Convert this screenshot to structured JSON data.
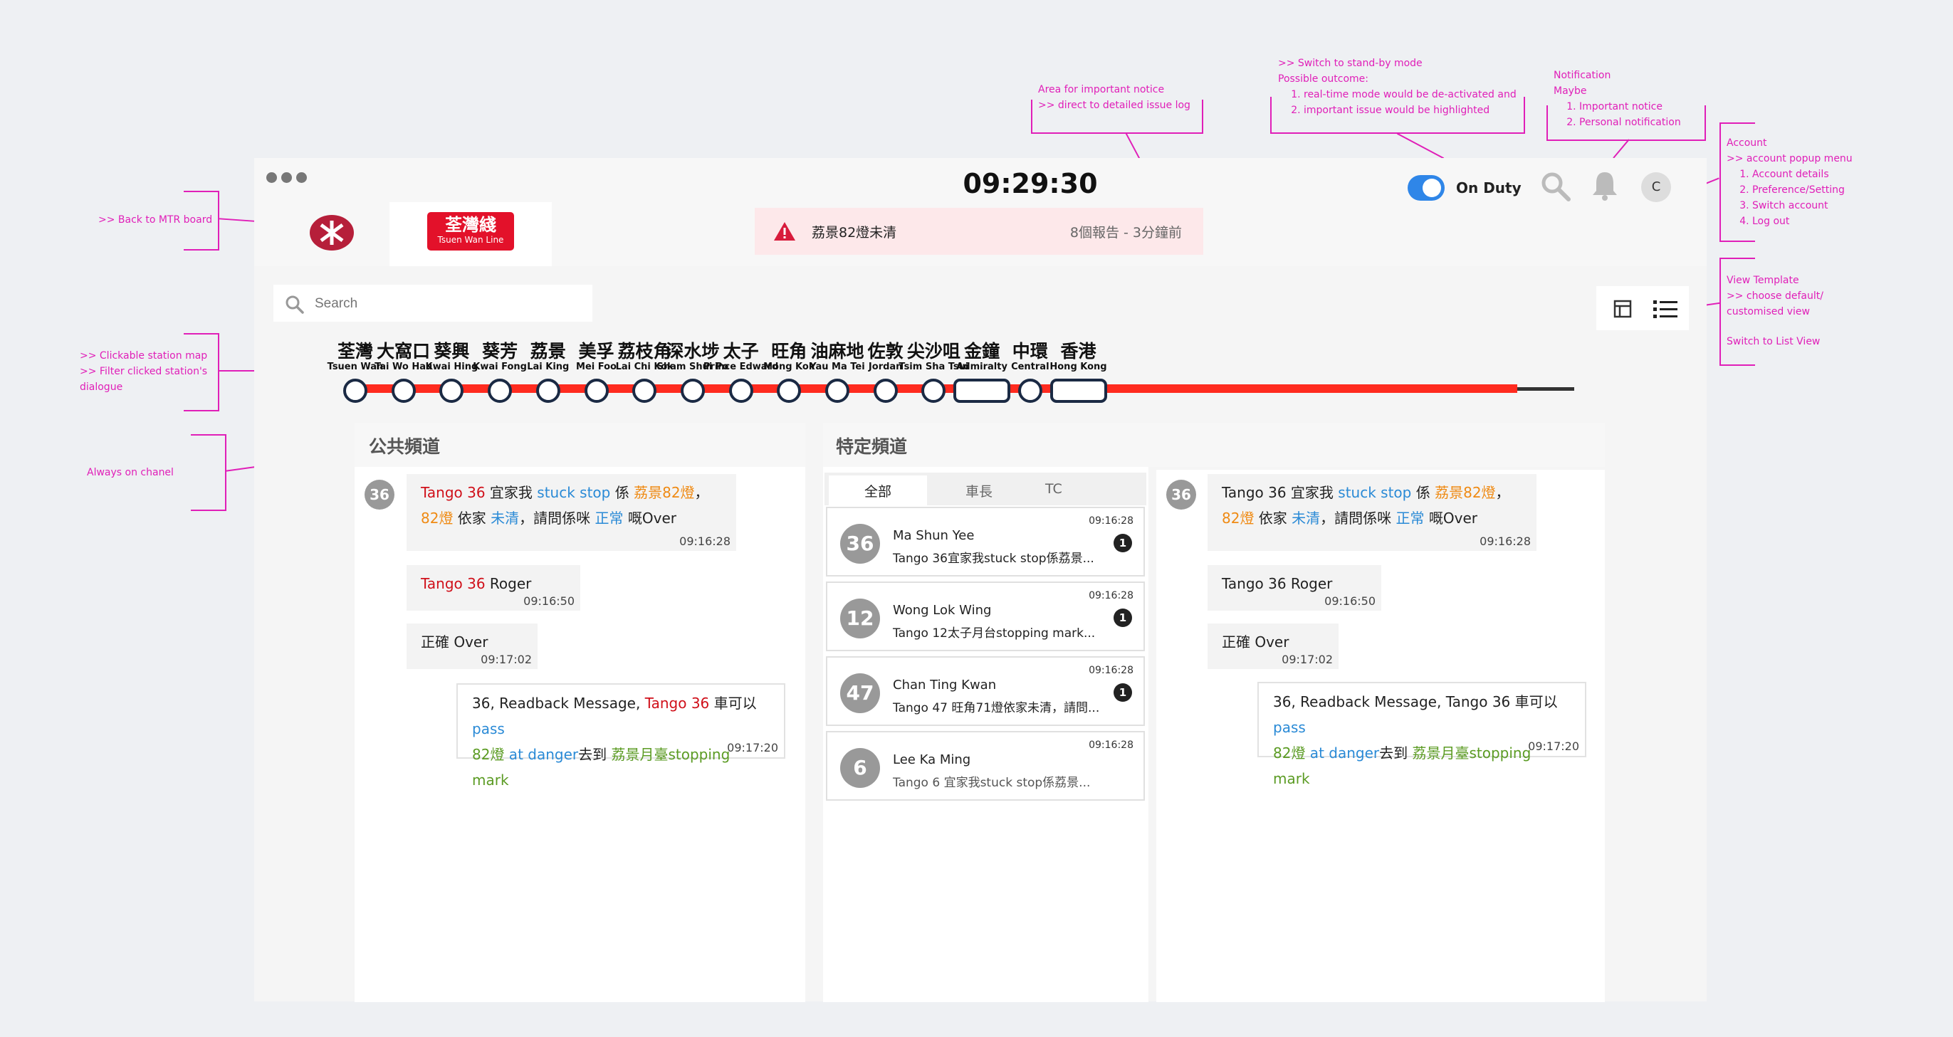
{
  "annotations": {
    "back": ">> Back to MTR board",
    "station_map": [
      ">> Clickable station map",
      ">> Filter clicked station's",
      "dialogue"
    ],
    "always_on": "Always on chanel",
    "notice_area": [
      "Area for important notice",
      ">> direct to detailed issue log"
    ],
    "standby_intro": [
      ">> Switch to stand-by mode",
      "Possible outcome:"
    ],
    "standby_items": [
      "real-time mode would be de-activated and",
      "important issue would be highlighted"
    ],
    "notification_intro": [
      "Notification",
      "Maybe"
    ],
    "notification_items": [
      "Important notice",
      "Personal notification"
    ],
    "account_intro": [
      "Account",
      ">> account popup menu"
    ],
    "account_items": [
      "Account details",
      "Preference/Setting",
      "Switch account",
      "Log out"
    ],
    "view_template": [
      "View Template",
      ">> choose default/",
      "customised view"
    ],
    "list_view": "Switch to List View"
  },
  "header": {
    "clock": "09:29:30",
    "line_tab_zh": "荃灣綫",
    "line_tab_en": "Tsuen Wan Line",
    "notice_text": "荔景82燈未清",
    "notice_meta": "8個報告 - 3分鐘前",
    "duty_label": "On Duty",
    "avatar_initial": "C",
    "search_placeholder": "Search"
  },
  "colors": {
    "line_red": "#ff2b1f",
    "accent_blue": "#2f86e8",
    "mtr_red": "#b61f3a"
  },
  "stations": [
    {
      "zh": "荃灣",
      "en": "Tsuen Wan"
    },
    {
      "zh": "大窩口",
      "en": "Tai Wo Hau"
    },
    {
      "zh": "葵興",
      "en": "Kwai Hing"
    },
    {
      "zh": "葵芳",
      "en": "Kwai Fong"
    },
    {
      "zh": "荔景",
      "en": "Lai King"
    },
    {
      "zh": "美孚",
      "en": "Mei Foo"
    },
    {
      "zh": "荔枝角",
      "en": "Lai Chi Kok"
    },
    {
      "zh": "深水埗",
      "en": "Sham Shui Po"
    },
    {
      "zh": "太子",
      "en": "Prince Edward"
    },
    {
      "zh": "旺角",
      "en": "Mong Kok"
    },
    {
      "zh": "油麻地",
      "en": "Yau Ma Tei"
    },
    {
      "zh": "佐敦",
      "en": "Jordan"
    },
    {
      "zh": "尖沙咀",
      "en": "Tsim Sha Tsui"
    },
    {
      "zh": "金鐘",
      "en": "Admiralty"
    },
    {
      "zh": "中環",
      "en": "Central"
    },
    {
      "zh": "香港",
      "en": "Hong Kong"
    }
  ],
  "public_channel": {
    "title": "公共頻道",
    "badge": "36",
    "msg1": {
      "p1": "Tango 36",
      "p2": " 宜家我 ",
      "p3": "stuck stop",
      "p4": " 係 ",
      "p5": "荔景82燈",
      "p6": "，",
      "p7": "82燈",
      "p8": " 依家 ",
      "p9": "未清",
      "p10": "，請問係咪 ",
      "p11": "正常",
      "p12": " 嘅Over",
      "time": "09:16:28"
    },
    "msg2": {
      "p1": "Tango 36",
      "p2": " Roger",
      "time": "09:16:50"
    },
    "msg3": {
      "text": "正確 Over",
      "time": "09:17:02"
    },
    "msg4": {
      "p1": "36, Readback Message, ",
      "p2": "Tango 36",
      "p3": " 車可以",
      "p4": "pass",
      "p5": "82燈",
      "p6": " at danger",
      "p7": "去到 ",
      "p8": "荔景月臺stopping mark",
      "time": "09:17:20"
    }
  },
  "specific_channel": {
    "title": "特定頻道",
    "tabs": [
      "全部",
      "車長",
      "TC"
    ],
    "contacts": [
      {
        "num": "36",
        "name": "Ma Shun Yee",
        "preview": "Tango 36宜家我stuck stop係荔景...",
        "time": "09:16:28",
        "count": "1"
      },
      {
        "num": "12",
        "name": "Wong Lok Wing",
        "preview": "Tango 12太子月台stopping mark...",
        "time": "09:16:28",
        "count": "1"
      },
      {
        "num": "47",
        "name": "Chan Ting Kwan",
        "preview": "Tango 47 旺角71燈依家未清，請問...",
        "time": "09:16:28",
        "count": "1"
      },
      {
        "num": "6",
        "name": "Lee Ka Ming",
        "preview": "Tango 6 宜家我stuck stop係荔景...",
        "time": "09:16:28",
        "count": ""
      }
    ],
    "badge": "36",
    "msg1": {
      "p1": "Tango 36",
      "p2": " 宜家我 ",
      "p3": "stuck stop",
      "p4": " 係 ",
      "p5": "荔景82燈",
      "p6": "，",
      "p7": "82燈",
      "p8": " 依家 ",
      "p9": "未清",
      "p10": "，請問係咪 ",
      "p11": "正常",
      "p12": " 嘅Over",
      "time": "09:16:28"
    },
    "msg2": {
      "p1": "Tango 36 Roger",
      "time": "09:16:50"
    },
    "msg3": {
      "text": "正確 Over",
      "time": "09:17:02"
    },
    "msg4": {
      "p1": "36, Readback Message, ",
      "p2": "Tango 36",
      "p3": " 車可以",
      "p4": "pass",
      "p5": "82燈",
      "p6": " at danger",
      "p7": "去到 ",
      "p8": "荔景月臺stopping mark",
      "time": "09:17:20"
    }
  }
}
